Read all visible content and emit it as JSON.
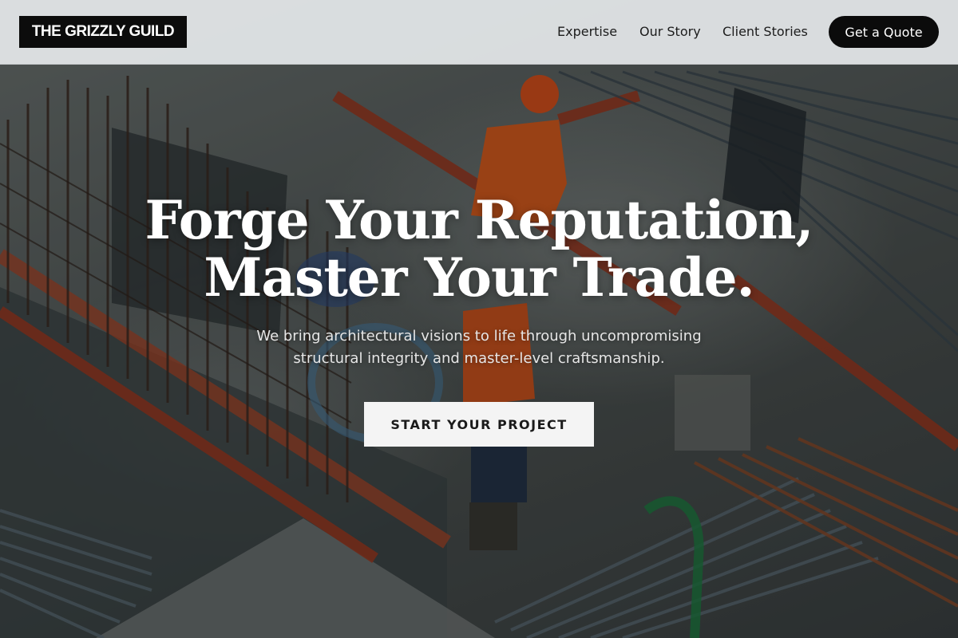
{
  "header": {
    "logo_text": "THE GRIZZLY GUILD",
    "nav": [
      {
        "label": "Expertise"
      },
      {
        "label": "Our Story"
      },
      {
        "label": "Client Stories"
      }
    ],
    "quote_button": "Get a Quote"
  },
  "hero": {
    "headline_line1": "Forge Your Reputation,",
    "headline_line2": "Master Your Trade.",
    "subtext": "We bring architectural visions to life through uncompromising structural integrity and master-level craftsmanship.",
    "cta_label": "START YOUR PROJECT"
  },
  "colors": {
    "header_bg": "#e6e9ec",
    "logo_bg": "#0c0c0c",
    "quote_button_bg": "#0b0b0b",
    "cta_bg": "#f4f4f4"
  }
}
